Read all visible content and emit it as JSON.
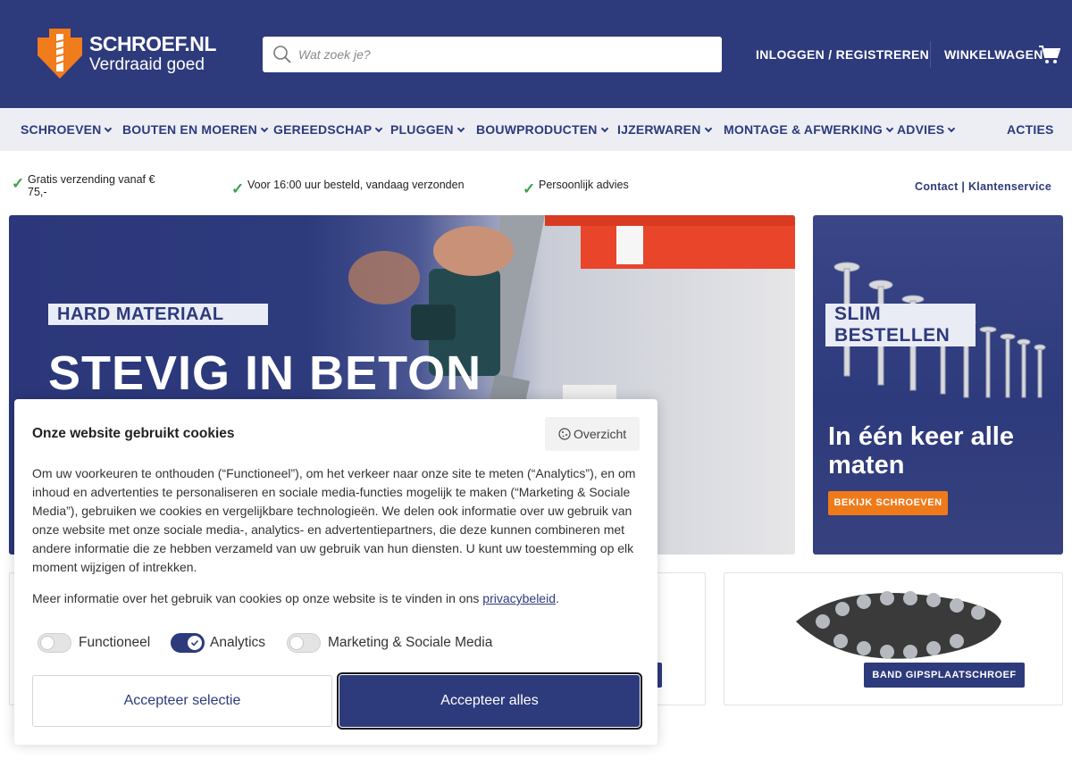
{
  "header": {
    "logo_name": "SCHROEF.NL",
    "logo_tagline": "Verdraaid goed",
    "search_placeholder": "Wat zoek je?",
    "login_label": "INLOGGEN / REGISTREREN",
    "cart_label": "WINKELWAGEN",
    "icons": [
      "screw-logo-icon",
      "search-icon",
      "cart-icon"
    ]
  },
  "nav": {
    "items": [
      {
        "label": "SCHROEVEN"
      },
      {
        "label": "BOUTEN EN MOEREN"
      },
      {
        "label": "GEREEDSCHAP"
      },
      {
        "label": "PLUGGEN"
      },
      {
        "label": "BOUWPRODUCTEN"
      },
      {
        "label": "IJZERWAREN"
      },
      {
        "label": "MONTAGE & AFWERKING"
      },
      {
        "label": "ADVIES"
      }
    ],
    "actions_label": "ACTIES"
  },
  "usp": {
    "items": [
      {
        "text": "Gratis verzending vanaf € 75,-"
      },
      {
        "text": "Voor 16:00 uur besteld, vandaag verzonden"
      },
      {
        "text": "Persoonlijk advies"
      }
    ],
    "contact_label": "Contact",
    "separator": " | ",
    "service_label": "Klantenservice"
  },
  "hero": {
    "tag": "HARD MATERIAAL",
    "title": "STEVIG IN BETON"
  },
  "promo": {
    "tag": "SLIM BESTELLEN",
    "title": "In één keer alle maten",
    "button": "BEKIJK SCHROEVEN"
  },
  "tiles": [
    {
      "button": "BAND GIPSPLAATSCHROEF"
    }
  ],
  "cookie": {
    "title": "Onze website gebruikt cookies",
    "overview_label": "Overzicht",
    "body": "Om uw voorkeuren te onthouden (“Functioneel”), om het verkeer naar onze site te meten (“Analytics”), en om inhoud en advertenties te personaliseren en sociale media-functies mogelijk te maken (“Marketing & Sociale Media”), gebruiken we cookies en vergelijkbare technologieën. We delen ook informatie over uw gebruik van onze website met onze sociale media-, analytics- en advertentiepartners, die deze kunnen combineren met andere informatie die ze hebben verzameld van uw gebruik van hun diensten. U kunt uw toestemming op elk moment wijzigen of intrekken.",
    "more_text": "Meer informatie over het gebruik van cookies op onze website is te vinden in ons ",
    "privacy_link": "privacybeleid",
    "more_end": ".",
    "toggles": [
      {
        "label": "Functioneel",
        "on": false
      },
      {
        "label": "Analytics",
        "on": true
      },
      {
        "label": "Marketing & Sociale Media",
        "on": false
      }
    ],
    "accept_selection": "Accepteer selectie",
    "accept_all": "Accepteer alles"
  },
  "colors": {
    "brand_blue": "#2d3a7c",
    "accent_orange": "#ef7a1a",
    "check_green": "#3aa24a"
  }
}
